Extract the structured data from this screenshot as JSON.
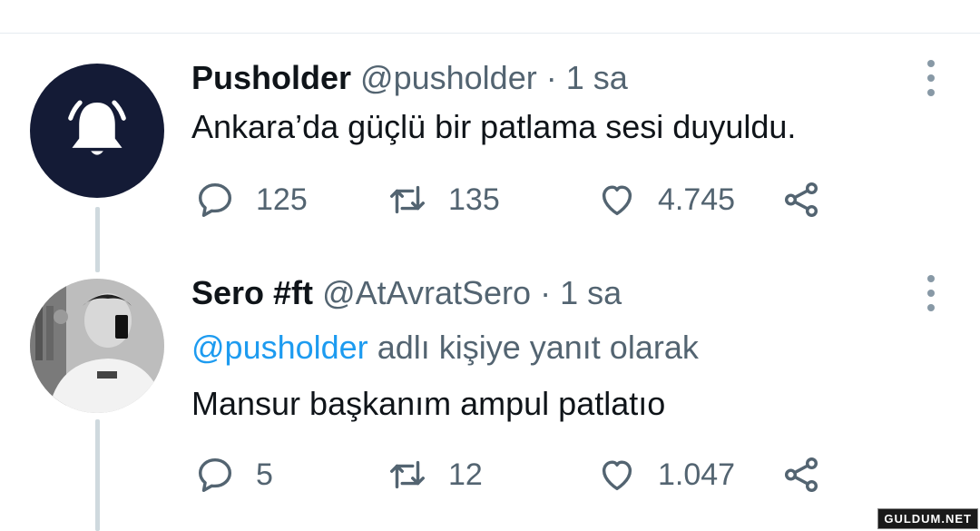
{
  "tweets": [
    {
      "display_name": "Pusholder",
      "handle": "@pusholder",
      "separator": "·",
      "time": "1 sa",
      "text": "Ankara’da güçlü bir patlama sesi duyuldu.",
      "avatar_icon": "bell-icon",
      "stats": {
        "replies": "125",
        "retweets": "135",
        "likes": "4.745"
      }
    },
    {
      "display_name": "Sero #ft",
      "handle": "@AtAvratSero",
      "separator": "·",
      "time": "1 sa",
      "reply_to_handle": "@pusholder",
      "reply_to_rest": "adlı kişiye yanıt olarak",
      "text": "Mansur başkanım ampul patlatıo",
      "avatar_icon": "user-photo",
      "stats": {
        "replies": "5",
        "retweets": "12",
        "likes": "1.047"
      }
    }
  ],
  "watermark": "GULDUM.NET",
  "colors": {
    "accent": "#1d9bf0",
    "muted": "#536471",
    "avatar_bg": "#141b36"
  }
}
